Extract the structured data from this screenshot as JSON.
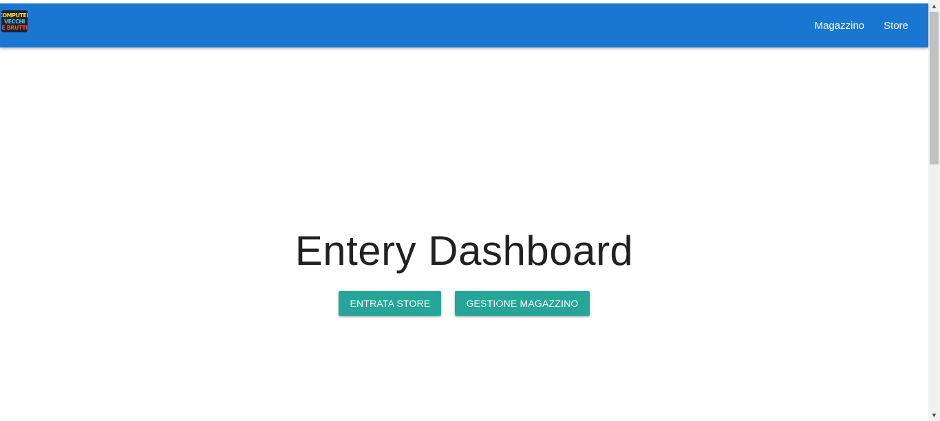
{
  "navbar": {
    "brand_logo_text": [
      "COMPUTER",
      "VECCHI",
      "E BRUTTI"
    ],
    "links": [
      {
        "label": "Magazzino"
      },
      {
        "label": "Store"
      }
    ],
    "background_color": "#1976d2"
  },
  "hero": {
    "title": "Entery Dashboard",
    "buttons": [
      {
        "label": "ENTRATA STORE"
      },
      {
        "label": "GESTIONE MAGAZZINO"
      }
    ],
    "button_color": "#26a69a"
  },
  "scrollbar": {
    "up_icon": "scroll-up-arrow-icon",
    "down_icon": "scroll-down-arrow-icon"
  }
}
